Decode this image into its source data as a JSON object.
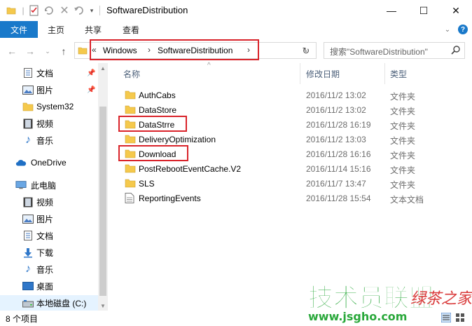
{
  "window": {
    "title": "SoftwareDistribution",
    "minimize": "—",
    "maximize": "☐",
    "close": "✕"
  },
  "ribbon": {
    "file": "文件",
    "tabs": [
      "主页",
      "共享",
      "查看"
    ]
  },
  "address": {
    "overflow": "«",
    "crumbs": [
      "Windows",
      "SoftwareDistribution"
    ],
    "chevron": "›"
  },
  "search": {
    "placeholder": "搜索\"SoftwareDistribution\""
  },
  "nav": {
    "quick": [
      {
        "label": "文档",
        "icon": "document-icon",
        "pinned": true
      },
      {
        "label": "图片",
        "icon": "pictures-icon",
        "pinned": true
      },
      {
        "label": "System32",
        "icon": "folder-icon",
        "pinned": false
      },
      {
        "label": "视频",
        "icon": "video-icon",
        "pinned": false
      },
      {
        "label": "音乐",
        "icon": "music-icon",
        "pinned": false
      }
    ],
    "onedrive": "OneDrive",
    "thispc": "此电脑",
    "pc_items": [
      {
        "label": "视频",
        "icon": "video-icon"
      },
      {
        "label": "图片",
        "icon": "pictures-icon"
      },
      {
        "label": "文档",
        "icon": "document-icon"
      },
      {
        "label": "下载",
        "icon": "download-icon"
      },
      {
        "label": "音乐",
        "icon": "music-icon"
      },
      {
        "label": "桌面",
        "icon": "desktop-icon"
      },
      {
        "label": "本地磁盘 (C:)",
        "icon": "drive-icon"
      }
    ]
  },
  "columns": {
    "name": "名称",
    "date": "修改日期",
    "type": "类型"
  },
  "files": [
    {
      "name": "AuthCabs",
      "date": "2016/11/2 13:02",
      "type": "文件夹",
      "kind": "folder"
    },
    {
      "name": "DataStore",
      "date": "2016/11/2 13:02",
      "type": "文件夹",
      "kind": "folder"
    },
    {
      "name": "DataStrre",
      "date": "2016/11/28 16:19",
      "type": "文件夹",
      "kind": "folder"
    },
    {
      "name": "DeliveryOptimization",
      "date": "2016/11/2 13:03",
      "type": "文件夹",
      "kind": "folder"
    },
    {
      "name": "Download",
      "date": "2016/11/28 16:16",
      "type": "文件夹",
      "kind": "folder"
    },
    {
      "name": "PostRebootEventCache.V2",
      "date": "2016/11/14 15:16",
      "type": "文件夹",
      "kind": "folder"
    },
    {
      "name": "SLS",
      "date": "2016/11/7 13:47",
      "type": "文件夹",
      "kind": "folder"
    },
    {
      "name": "ReportingEvents",
      "date": "2016/11/28 15:54",
      "type": "文本文档",
      "kind": "text"
    }
  ],
  "status": {
    "count": "8 个项目"
  },
  "watermark": {
    "main": "技术员联盟",
    "sub": "www.jsgho.com",
    "red": "绿茶之家"
  },
  "colors": {
    "accent": "#1979ca",
    "folder": "#f5c94c",
    "highlight": "#d9232a",
    "watermark_green": "#2aa83b"
  }
}
